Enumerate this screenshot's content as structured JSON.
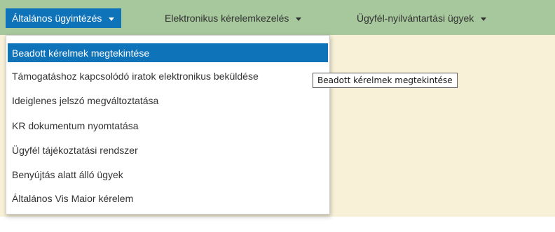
{
  "navbar": {
    "items": [
      {
        "label": "Általános ügyintézés",
        "active": true
      },
      {
        "label": "Elektronikus kérelemkezelés",
        "active": false
      },
      {
        "label": "Ügyfél-nyilvántartási ügyek",
        "active": false
      }
    ]
  },
  "dropdown": {
    "items": [
      {
        "label": "Beadott kérelmek megtekintése",
        "highlighted": true
      },
      {
        "label": "Támogatáshoz kapcsolódó iratok elektronikus beküldése"
      },
      {
        "label": "Ideiglenes jelszó megváltoztatása"
      },
      {
        "label": "KR dokumentum nyomtatása"
      },
      {
        "label": "Ügyfél tájékoztatási rendszer"
      },
      {
        "label": "Benyújtás alatt álló ügyek"
      },
      {
        "label": "Általános Vis Maior kérelem"
      }
    ]
  },
  "tooltip": {
    "text": "Beadott kérelmek megtekintése"
  },
  "colors": {
    "navbar_bg": "#a7c79c",
    "accent": "#0f73b9",
    "page_bg": "#f8f1d8"
  }
}
